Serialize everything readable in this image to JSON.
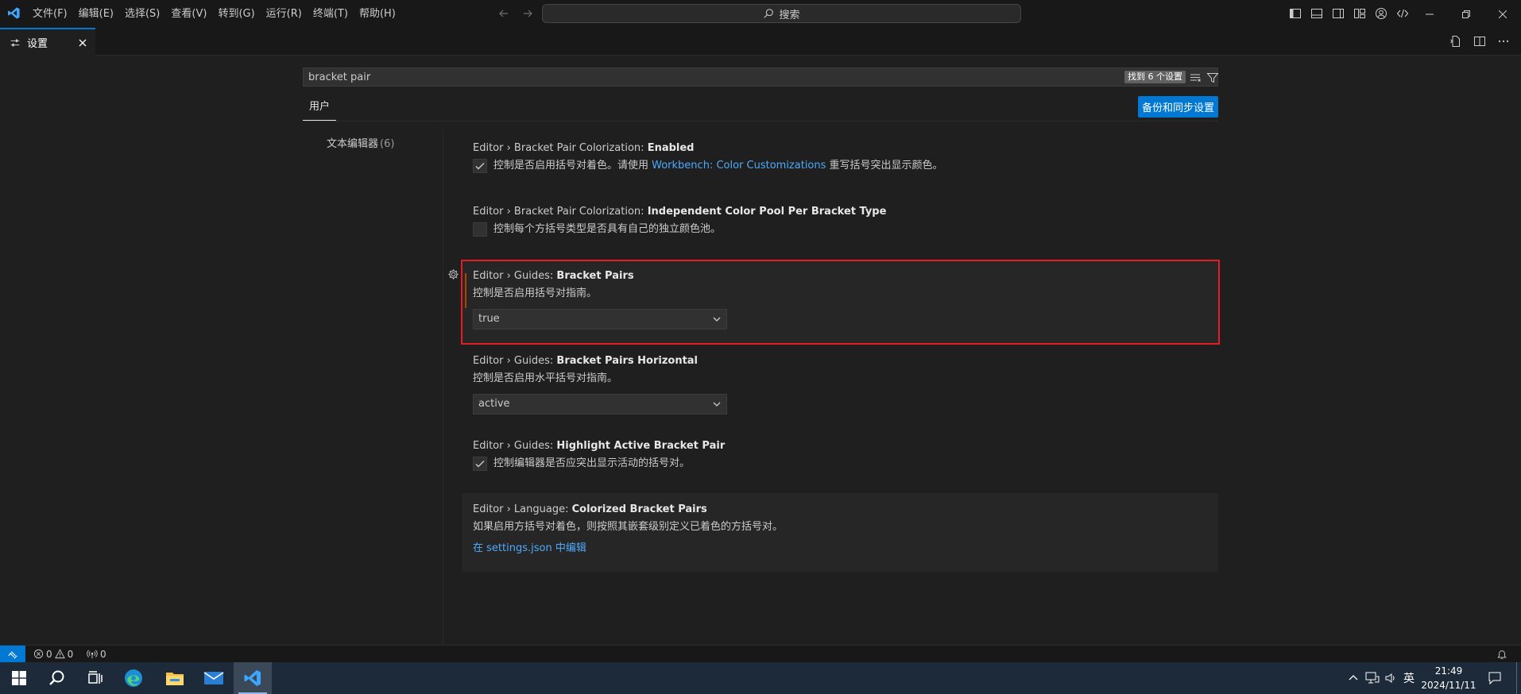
{
  "titlebar": {
    "menus": [
      "文件(F)",
      "编辑(E)",
      "选择(S)",
      "查看(V)",
      "转到(G)",
      "运行(R)",
      "终端(T)",
      "帮助(H)"
    ],
    "command_center": "搜索"
  },
  "tab": {
    "label": "设置"
  },
  "settings": {
    "search_value": "bracket pair",
    "result_count": "找到 6 个设置",
    "scope_tab": "用户",
    "backup_button": "备份和同步设置",
    "toc": {
      "label": "文本编辑器",
      "count": "(6)"
    },
    "items": [
      {
        "category": "Editor › Bracket Pair Colorization: ",
        "name": "Enabled",
        "desc_before": "控制是否启用括号对着色。请使用 ",
        "desc_link": "Workbench: Color Customizations",
        "desc_after": " 重写括号突出显示颜色。",
        "checked": true
      },
      {
        "category": "Editor › Bracket Pair Colorization: ",
        "name": "Independent Color Pool Per Bracket Type",
        "desc": "控制每个方括号类型是否具有自己的独立颜色池。",
        "checked": false
      },
      {
        "category": "Editor › Guides: ",
        "name": "Bracket Pairs",
        "desc": "控制是否启用括号对指南。",
        "value": "true"
      },
      {
        "category": "Editor › Guides: ",
        "name": "Bracket Pairs Horizontal",
        "desc": "控制是否启用水平括号对指南。",
        "value": "active"
      },
      {
        "category": "Editor › Guides: ",
        "name": "Highlight Active Bracket Pair",
        "desc": "控制编辑器是否应突出显示活动的括号对。",
        "checked": true
      },
      {
        "category": "Editor › Language: ",
        "name": "Colorized Bracket Pairs",
        "desc": "如果启用方括号对着色，则按照其嵌套级别定义已着色的方括号对。",
        "link": "在 settings.json 中编辑"
      }
    ]
  },
  "statusbar": {
    "errors": "0",
    "warnings": "0",
    "ports": "0"
  },
  "taskbar": {
    "apps": [
      "windows-start-icon",
      "search-icon",
      "task-view-icon",
      "edge-icon",
      "file-explorer-icon",
      "mail-icon",
      "vscode-icon"
    ],
    "ime": "英",
    "time": "21:49",
    "date": "2024/11/11"
  },
  "colors": {
    "accent": "#0078d4",
    "highlight_box": "#e51c23",
    "link": "#4daafc",
    "modified_bar": "#ad4500"
  }
}
